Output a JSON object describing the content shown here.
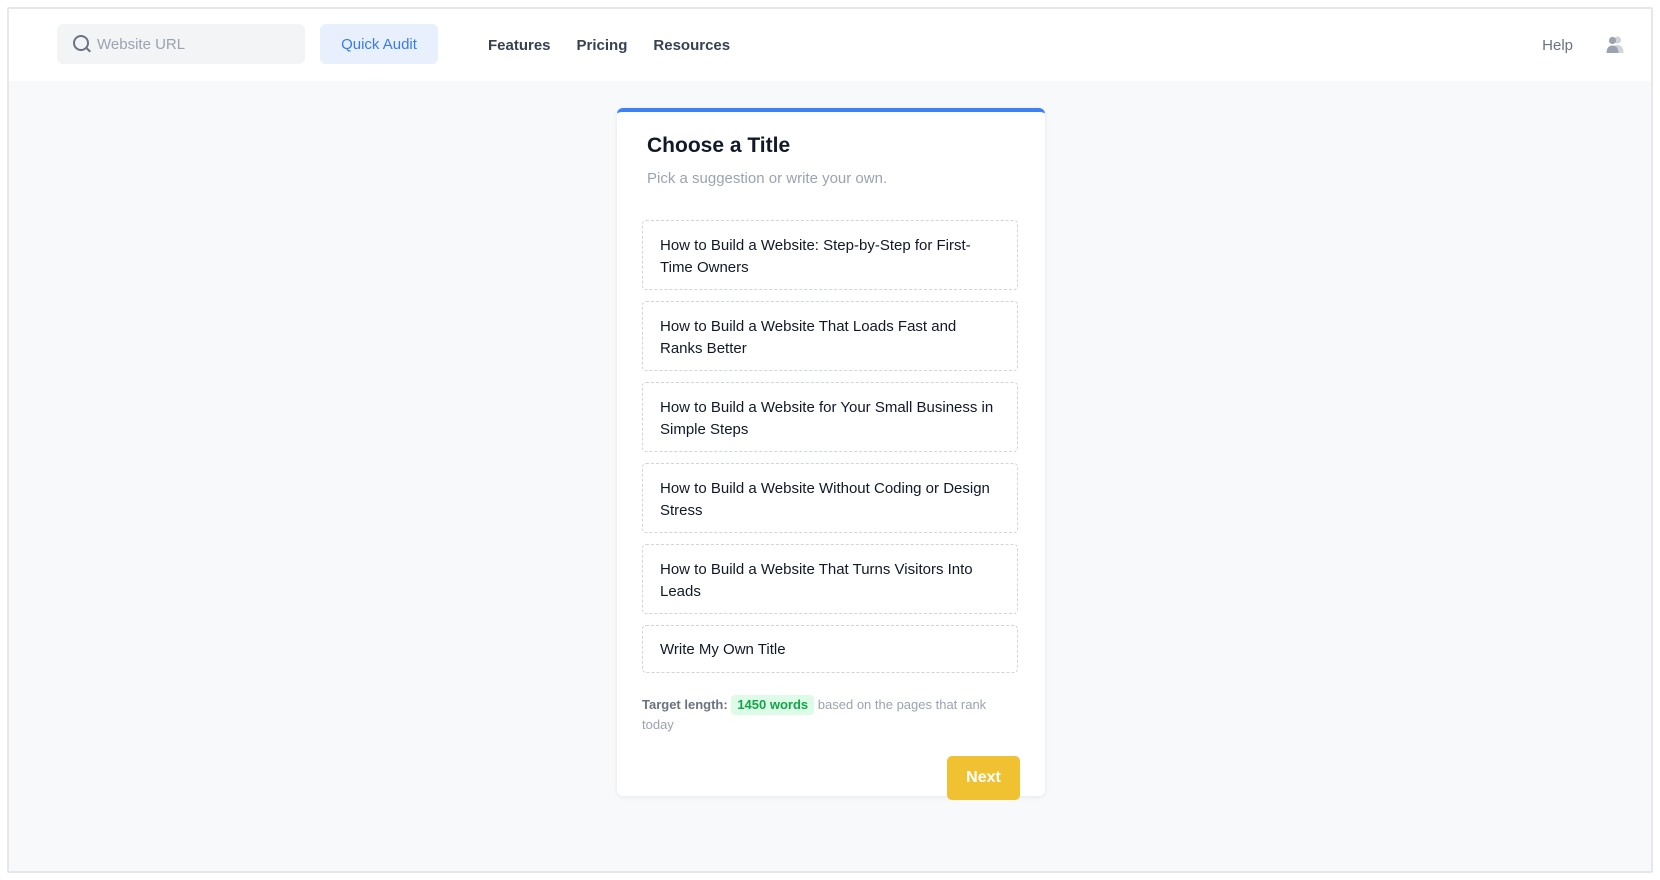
{
  "header": {
    "search": {
      "placeholder": "Website URL",
      "value": ""
    },
    "quick_audit_label": "Quick Audit",
    "nav": [
      "Features",
      "Pricing",
      "Resources"
    ],
    "help_label": "Help",
    "avatar_icon": "user-group-icon"
  },
  "card": {
    "title": "Choose a Title",
    "subtitle": "Pick a suggestion or write your own.",
    "options": [
      "How to Build a Website: Step-by-Step for First-Time Owners",
      "How to Build a Website That Loads Fast and Ranks Better",
      "How to Build a Website for Your Small Business in Simple Steps",
      "How to Build a Website Without Coding or Design Stress",
      "How to Build a Website That Turns Visitors Into Leads",
      "Write My Own Title"
    ],
    "target": {
      "label": "Target length:",
      "badge": "1450 words",
      "suffix": "based on the pages that rank today"
    },
    "next_label": "Next"
  },
  "colors": {
    "accent": "#3b82f6",
    "quick_audit_bg": "#e8f0fe",
    "next_bg": "#f0c231",
    "badge_bg": "#dcfce7",
    "badge_text": "#16a34a"
  }
}
